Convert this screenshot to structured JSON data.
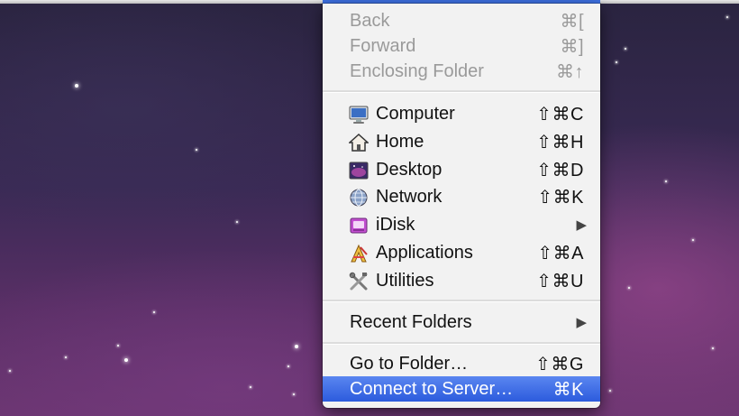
{
  "menu": {
    "history_items": [
      {
        "label": "Back",
        "shortcut": "⌘[",
        "enabled": false
      },
      {
        "label": "Forward",
        "shortcut": "⌘]",
        "enabled": false
      },
      {
        "label": "Enclosing Folder",
        "shortcut": "⌘↑",
        "enabled": false
      }
    ],
    "places": [
      {
        "label": "Computer",
        "shortcut": "⇧⌘C",
        "icon": "computer-icon"
      },
      {
        "label": "Home",
        "shortcut": "⇧⌘H",
        "icon": "home-icon"
      },
      {
        "label": "Desktop",
        "shortcut": "⇧⌘D",
        "icon": "desktop-icon"
      },
      {
        "label": "Network",
        "shortcut": "⇧⌘K",
        "icon": "network-icon"
      },
      {
        "label": "iDisk",
        "submenu_arrow": "▶",
        "icon": "idisk-icon"
      },
      {
        "label": "Applications",
        "shortcut": "⇧⌘A",
        "icon": "applications-icon"
      },
      {
        "label": "Utilities",
        "shortcut": "⇧⌘U",
        "icon": "utilities-icon"
      }
    ],
    "recent": {
      "label": "Recent Folders",
      "submenu_arrow": "▶"
    },
    "go_to_folder": {
      "label": "Go to Folder…",
      "shortcut": "⇧⌘G"
    },
    "connect_to_server": {
      "label": "Connect to Server…",
      "shortcut": "⌘K",
      "highlighted": true
    }
  },
  "colors": {
    "highlight": "#3d6fe0",
    "disabled_text": "#9a9a9a",
    "menu_background": "#f2f2f2"
  }
}
